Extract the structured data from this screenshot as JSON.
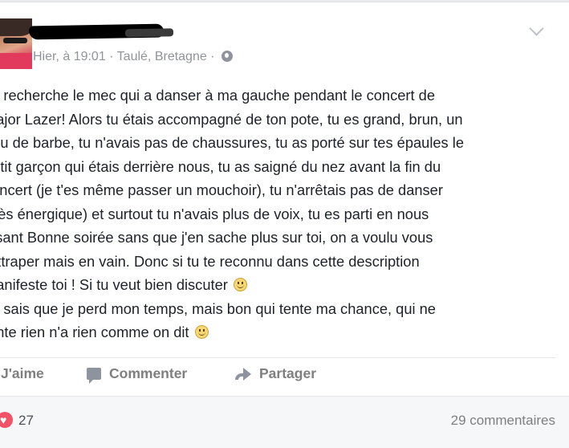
{
  "post": {
    "author_redacted": true,
    "timestamp": "Hier, à 19:01",
    "location": "Taulé, Bretagne",
    "separator": "·",
    "lines": [
      "Je recherche le mec qui a danser à ma gauche pendant le concert de",
      "Major Lazer! Alors tu étais accompagné de ton pote, tu es grand, brun, un",
      "peu de barbe, tu n'avais pas de chaussures, tu as porté sur tes épaules le",
      "petit garçon qui étais derrière nous, tu as saigné du nez avant la fin du",
      "concert (je t'es même passer un mouchoir), tu n'arrêtais pas de danser",
      "(très énergique) et surtout tu n'avais plus de voix, tu es parti en nous",
      "disant Bonne soirée sans que j'en sache plus sur toi, on a voulu vous",
      "rattraper mais en vain. Donc si tu te reconnu dans cette description",
      "manifeste toi ! Si tu veut bien discuter",
      "Je sais que je perd mon temps, mais bon qui tente ma chance, qui ne",
      "tente rien n'a rien comme on dit"
    ]
  },
  "actions": {
    "like": "J'aime",
    "comment": "Commenter",
    "share": "Partager"
  },
  "footer": {
    "reaction_count": "27",
    "comments": "29 commentaires"
  },
  "icons": {
    "reaction": "heart-icon",
    "comment": "comment-icon",
    "share": "share-arrow-icon",
    "privacy": "globe-icon",
    "menu": "chevron-down-icon",
    "emoji": "smiley-emoji-icon"
  },
  "colors": {
    "background": "#e9ebee",
    "card": "#ffffff",
    "meta_text": "#90949c",
    "action_text": "#7f7f7f",
    "heart": "#f25268"
  }
}
